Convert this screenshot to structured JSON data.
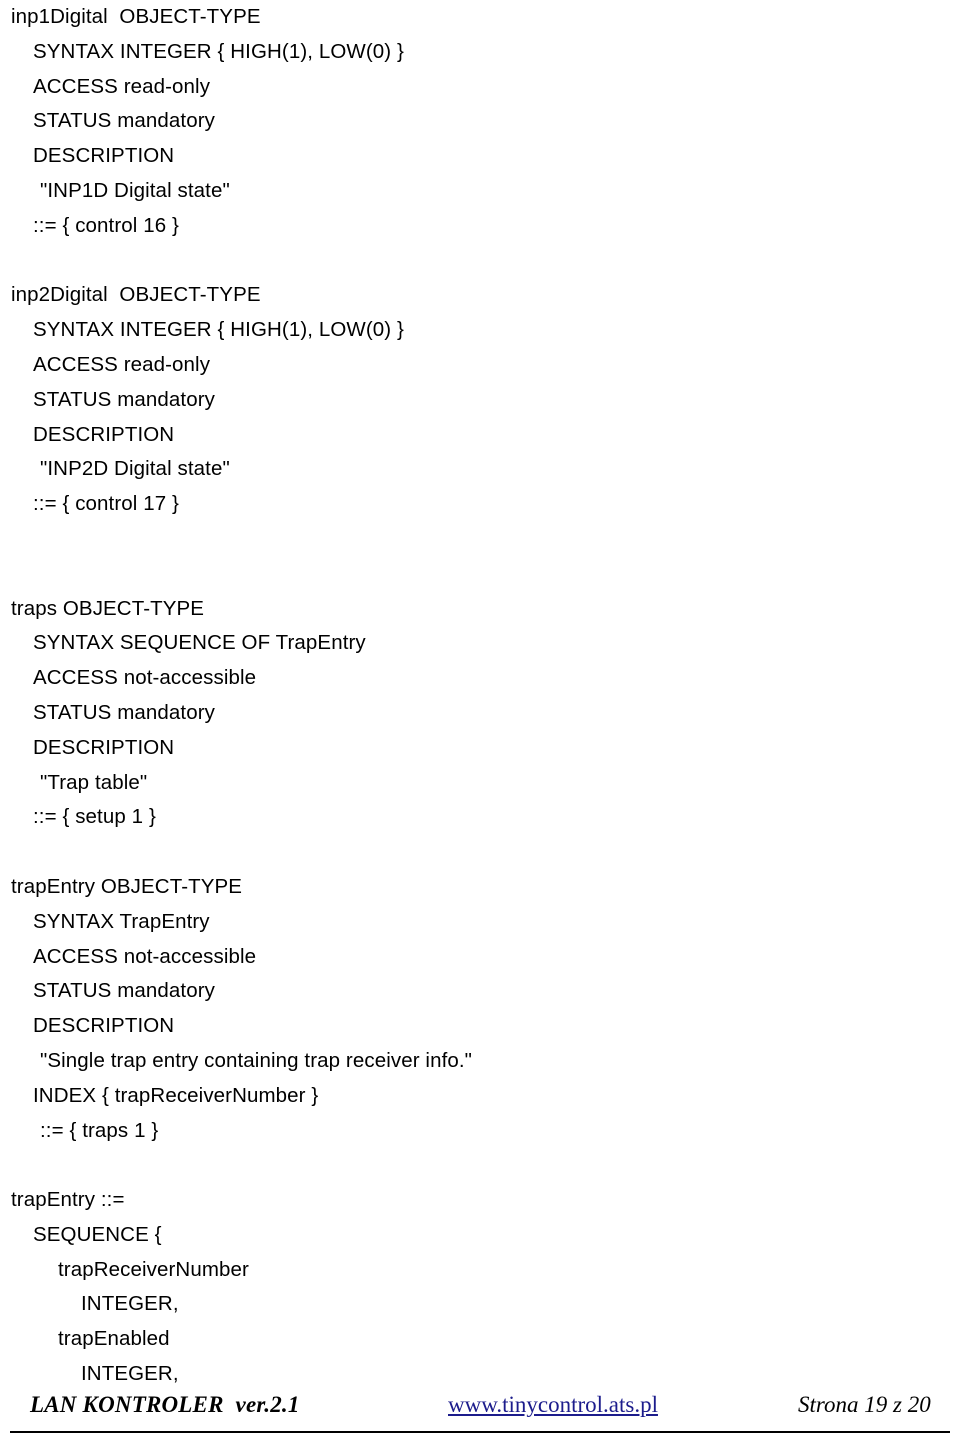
{
  "document": {
    "kind": "mib-definition-page",
    "text_color": "#000000",
    "background_color": "#ffffff",
    "blocks": [
      {
        "name": "inp1Digital",
        "lines": [
          {
            "indent": 0,
            "text": "inp1Digital  OBJECT-TYPE"
          },
          {
            "indent": 1,
            "text": "SYNTAX INTEGER { HIGH(1), LOW(0) }"
          },
          {
            "indent": 1,
            "text": "ACCESS read-only"
          },
          {
            "indent": 1,
            "text": "STATUS mandatory"
          },
          {
            "indent": 1,
            "text": "DESCRIPTION"
          },
          {
            "indent": 2,
            "text": "\"INP1D Digital state\""
          },
          {
            "indent": 1,
            "text": "::= { control 16 }"
          }
        ],
        "gap_after": 1
      },
      {
        "name": "inp2Digital",
        "lines": [
          {
            "indent": 0,
            "text": "inp2Digital  OBJECT-TYPE"
          },
          {
            "indent": 1,
            "text": "SYNTAX INTEGER { HIGH(1), LOW(0) }"
          },
          {
            "indent": 1,
            "text": "ACCESS read-only"
          },
          {
            "indent": 1,
            "text": "STATUS mandatory"
          },
          {
            "indent": 1,
            "text": "DESCRIPTION"
          },
          {
            "indent": 2,
            "text": "\"INP2D Digital state\""
          },
          {
            "indent": 1,
            "text": "::= { control 17 }"
          }
        ],
        "gap_after": 2
      },
      {
        "name": "traps",
        "lines": [
          {
            "indent": 0,
            "text": "traps OBJECT-TYPE"
          },
          {
            "indent": 1,
            "text": "SYNTAX SEQUENCE OF TrapEntry"
          },
          {
            "indent": 1,
            "text": "ACCESS not-accessible"
          },
          {
            "indent": 1,
            "text": "STATUS mandatory"
          },
          {
            "indent": 1,
            "text": "DESCRIPTION"
          },
          {
            "indent": 2,
            "text": "\"Trap table\""
          },
          {
            "indent": 1,
            "text": "::= { setup 1 }"
          }
        ],
        "gap_after": 1
      },
      {
        "name": "trapEntry",
        "lines": [
          {
            "indent": 0,
            "text": "trapEntry OBJECT-TYPE"
          },
          {
            "indent": 1,
            "text": "SYNTAX TrapEntry"
          },
          {
            "indent": 1,
            "text": "ACCESS not-accessible"
          },
          {
            "indent": 1,
            "text": "STATUS mandatory"
          },
          {
            "indent": 1,
            "text": "DESCRIPTION"
          },
          {
            "indent": 2,
            "text": "\"Single trap entry containing trap receiver info.\""
          },
          {
            "indent": 1,
            "text": "INDEX { trapReceiverNumber }"
          },
          {
            "indent": 2,
            "text": "::= { traps 1 }"
          }
        ],
        "gap_after": 1
      },
      {
        "name": "trapEntry-sequence",
        "lines": [
          {
            "indent": 0,
            "text": "trapEntry ::="
          },
          {
            "indent": 1,
            "text": "SEQUENCE {"
          },
          {
            "indent": 3,
            "text": "trapReceiverNumber"
          },
          {
            "indent": 4,
            "text": "INTEGER,"
          },
          {
            "indent": 3,
            "text": "trapEnabled"
          },
          {
            "indent": 4,
            "text": "INTEGER,"
          }
        ],
        "gap_after": 0
      }
    ]
  },
  "footer": {
    "title": "LAN KONTROLER  ver.2.1",
    "link": "www.tinycontrol.ats.pl",
    "link_color": "#1c1c8c",
    "page_number": "Strona 19 z 20"
  }
}
